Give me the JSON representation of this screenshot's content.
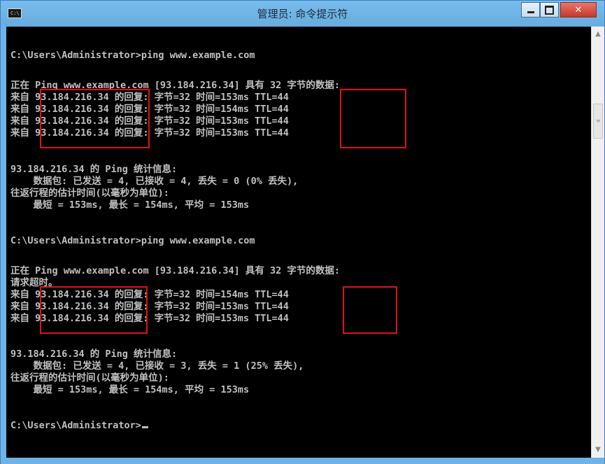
{
  "window": {
    "title": "管理员: 命令提示符",
    "icon_text": "C:\\",
    "buttons": {
      "minimize": "minimize-icon",
      "maximize": "maximize-icon",
      "close": "close-icon"
    }
  },
  "console": {
    "lines": [
      "C:\\Users\\Administrator>ping www.example.com",
      "",
      "正在 Ping www.example.com [93.184.216.34] 具有 32 字节的数据:",
      "来自 93.184.216.34 的回复: 字节=32 时间=153ms TTL=44",
      "来自 93.184.216.34 的回复: 字节=32 时间=154ms TTL=44",
      "来自 93.184.216.34 的回复: 字节=32 时间=153ms TTL=44",
      "来自 93.184.216.34 的回复: 字节=32 时间=153ms TTL=44",
      "",
      "93.184.216.34 的 Ping 统计信息:",
      "    数据包: 已发送 = 4, 已接收 = 4, 丢失 = 0 (0% 丢失),",
      "往返行程的估计时间(以毫秒为单位):",
      "    最短 = 153ms, 最长 = 154ms, 平均 = 153ms",
      "",
      "C:\\Users\\Administrator>ping www.example.com",
      "",
      "正在 Ping www.example.com [93.184.216.34] 具有 32 字节的数据:",
      "请求超时。",
      "来自 93.184.216.34 的回复: 字节=32 时间=154ms TTL=44",
      "来自 93.184.216.34 的回复: 字节=32 时间=153ms TTL=44",
      "来自 93.184.216.34 的回复: 字节=32 时间=153ms TTL=44",
      "",
      "93.184.216.34 的 Ping 统计信息:",
      "    数据包: 已发送 = 4, 已接收 = 3, 丢失 = 1 (25% 丢失),",
      "往返行程的估计时间(以毫秒为单位):",
      "    最短 = 153ms, 最长 = 154ms, 平均 = 153ms",
      "",
      "C:\\Users\\Administrator>"
    ]
  },
  "colors": {
    "console_bg": "#000000",
    "console_text": "#c0c0c0",
    "titlebar": "#6fb2e6",
    "highlight_border": "#e0101a",
    "close_button": "#c94a3d"
  },
  "scrollbar": {
    "up_icon": "scroll-up-arrow-icon",
    "down_icon": "scroll-down-arrow-icon"
  }
}
